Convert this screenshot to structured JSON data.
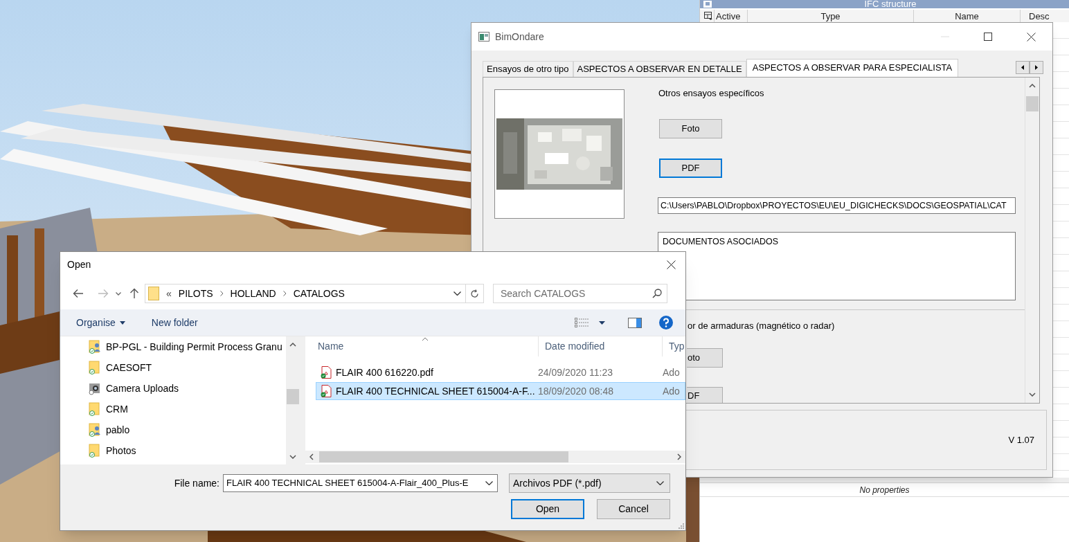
{
  "ifc_panel": {
    "title": "IFC structure",
    "columns": [
      "Active",
      "Type",
      "Name",
      "Desc"
    ],
    "empty_message": "No properties"
  },
  "bimondare": {
    "title": "BimOndare",
    "tabs": [
      {
        "label": "Ensayos de otro tipo",
        "selected": false
      },
      {
        "label": "ASPECTOS A OBSERVAR EN DETALLE",
        "selected": false
      },
      {
        "label": "ASPECTOS A OBSERVAR PARA ESPECIALISTA",
        "selected": true
      }
    ],
    "sections": [
      {
        "title": "Otros ensayos específicos",
        "buttons": [
          {
            "label": "Foto",
            "focused": false
          },
          {
            "label": "PDF",
            "focused": true
          }
        ],
        "path": "C:\\Users\\PABLO\\Dropbox\\PROYECTOS\\EU\\EU_DIGICHECKS\\DOCS\\GEOSPATIAL\\CAT",
        "documents": "DOCUMENTOS ASOCIADOS"
      },
      {
        "title": "or de armaduras (magnético o radar)",
        "buttons": [
          {
            "label": "oto",
            "focused": false
          },
          {
            "label": "DF",
            "focused": false
          }
        ]
      }
    ],
    "version": "V 1.07"
  },
  "open_dialog": {
    "title": "Open",
    "breadcrumb_overflow": "«",
    "breadcrumb": [
      "PILOTS",
      "HOLLAND",
      "CATALOGS"
    ],
    "search_placeholder": "Search CATALOGS",
    "toolbar": [
      "Organise",
      "New folder"
    ],
    "nav_items": [
      {
        "label": "BP-PGL - Building Permit Process Granu",
        "kind": "shared"
      },
      {
        "label": "CAESOFT",
        "kind": "folder"
      },
      {
        "label": "Camera Uploads",
        "kind": "camera"
      },
      {
        "label": "CRM",
        "kind": "folder"
      },
      {
        "label": "pablo",
        "kind": "shared"
      },
      {
        "label": "Photos",
        "kind": "folder"
      }
    ],
    "columns": [
      "Name",
      "Date modified",
      "Typ"
    ],
    "files": [
      {
        "name": "FLAIR 400 616220.pdf",
        "date": "24/09/2020 11:23",
        "type": "Ado",
        "selected": false
      },
      {
        "name": "FLAIR 400 TECHNICAL SHEET 615004-A-F...",
        "date": "18/09/2020 08:48",
        "type": "Ado",
        "selected": true
      }
    ],
    "file_name_label": "File name:",
    "file_name": "FLAIR 400 TECHNICAL SHEET 615004-A-Flair_400_Plus-E",
    "file_type": "Archivos PDF (*.pdf)",
    "buttons": [
      {
        "label": "Open",
        "default": true
      },
      {
        "label": "Cancel",
        "default": false
      }
    ]
  }
}
